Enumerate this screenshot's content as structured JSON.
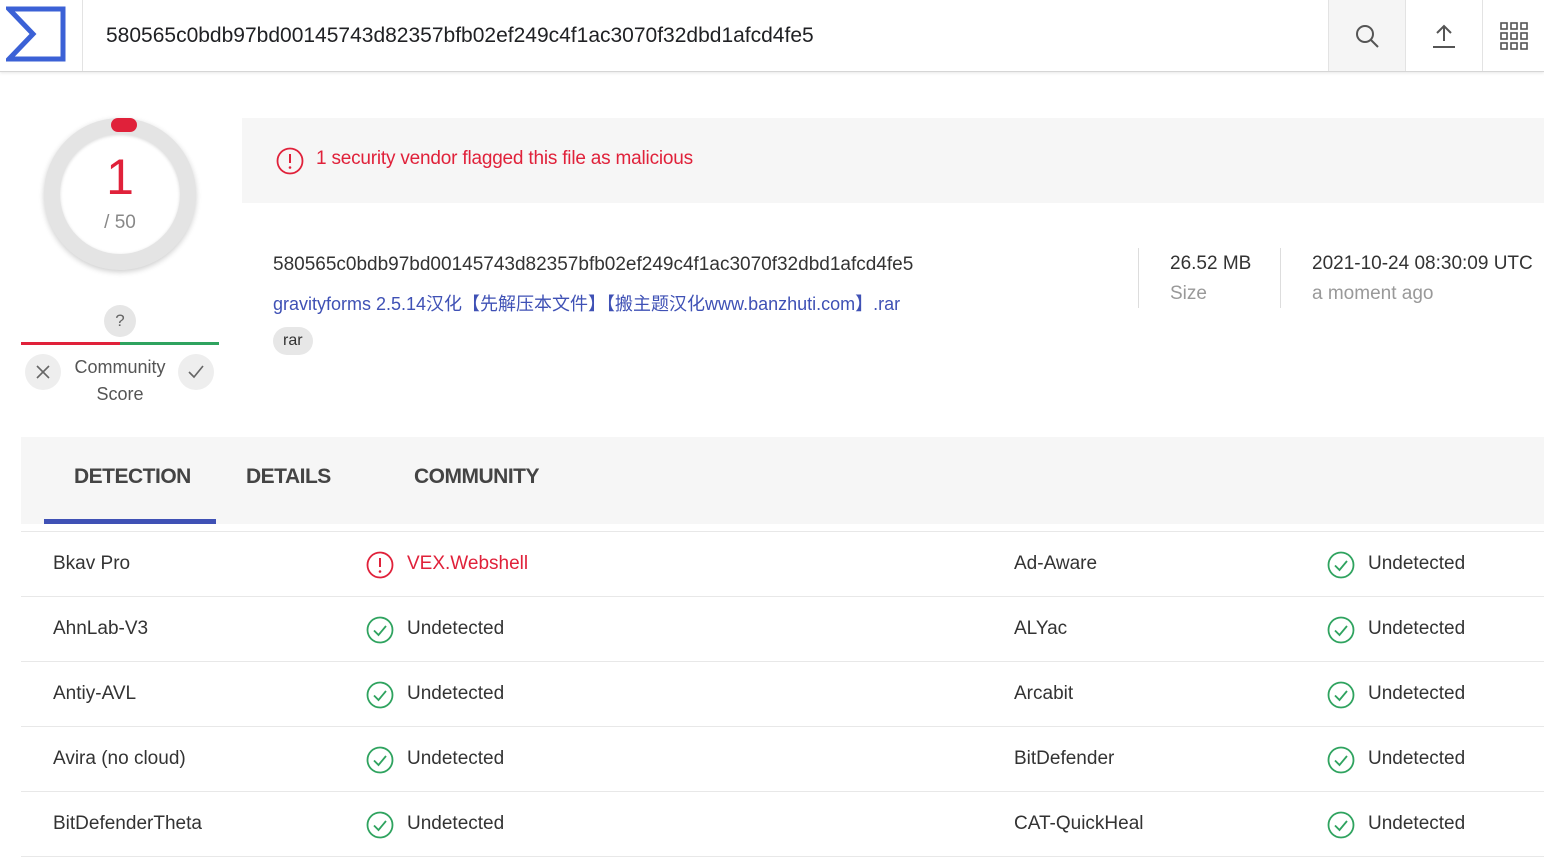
{
  "header": {
    "search_value": "580565c0bdb97bd00145743d82357bfb02ef249c4f1ac3070f32dbd1afcd4fe5"
  },
  "score": {
    "detections": "1",
    "total": "/ 50",
    "community_question": "?",
    "community_label_line1": "Community",
    "community_label_line2": "Score"
  },
  "alert": {
    "text": "1 security vendor flagged this file as malicious"
  },
  "file": {
    "hash": "580565c0bdb97bd00145743d82357bfb02ef249c4f1ac3070f32dbd1afcd4fe5",
    "name": "gravityforms 2.5.14汉化【先解压本文件】【搬主题汉化www.banzhuti.com】.rar",
    "tag": "rar",
    "size": "26.52 MB",
    "size_label": "Size",
    "date": "2021-10-24 08:30:09 UTC",
    "date_label": "a moment ago"
  },
  "tabs": [
    "DETECTION",
    "DETAILS",
    "COMMUNITY"
  ],
  "colors": {
    "malicious": "#e0213a",
    "clean": "#2fa35f",
    "accent": "#3f51b5"
  },
  "detections": [
    {
      "left_vendor": "Bkav Pro",
      "left_result": "VEX.Webshell",
      "left_status": "malicious",
      "right_vendor": "Ad-Aware",
      "right_result": "Undetected",
      "right_status": "clean"
    },
    {
      "left_vendor": "AhnLab-V3",
      "left_result": "Undetected",
      "left_status": "clean",
      "right_vendor": "ALYac",
      "right_result": "Undetected",
      "right_status": "clean"
    },
    {
      "left_vendor": "Antiy-AVL",
      "left_result": "Undetected",
      "left_status": "clean",
      "right_vendor": "Arcabit",
      "right_result": "Undetected",
      "right_status": "clean"
    },
    {
      "left_vendor": "Avira (no cloud)",
      "left_result": "Undetected",
      "left_status": "clean",
      "right_vendor": "BitDefender",
      "right_result": "Undetected",
      "right_status": "clean"
    },
    {
      "left_vendor": "BitDefenderTheta",
      "left_result": "Undetected",
      "left_status": "clean",
      "right_vendor": "CAT-QuickHeal",
      "right_result": "Undetected",
      "right_status": "clean"
    }
  ]
}
